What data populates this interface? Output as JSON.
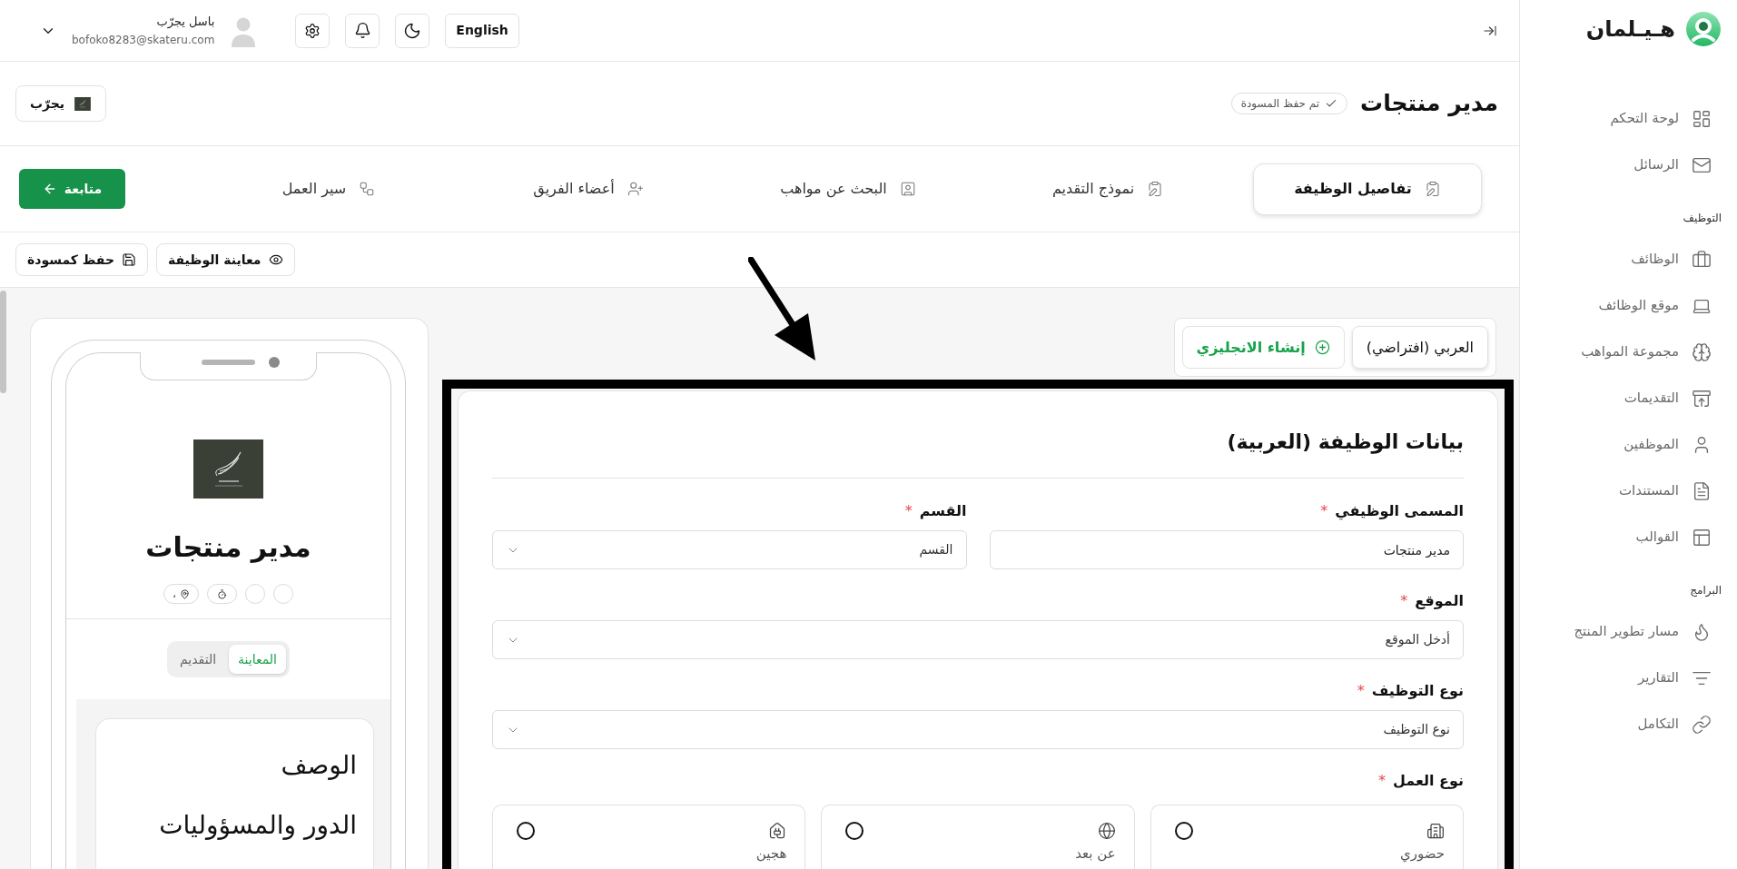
{
  "topbar": {
    "language_button": "English",
    "user": {
      "name": "باسل يجرّب",
      "email": "bofoko8283@skateru.com"
    }
  },
  "sidebar": {
    "logo_text": "هـيـلمان",
    "sections": [
      {
        "items": [
          {
            "label": "لوحة التحكم",
            "selected": false
          },
          {
            "label": "الرسائل",
            "selected": false
          }
        ]
      },
      {
        "heading": "التوظيف",
        "items": [
          {
            "label": "الوظائف",
            "selected": false
          },
          {
            "label": "موقع الوظائف",
            "selected": false
          },
          {
            "label": "مجموعة المواهب",
            "selected": false
          },
          {
            "label": "التقديمات",
            "selected": false
          },
          {
            "label": "الموظفين",
            "selected": false
          },
          {
            "label": "المستندات",
            "selected": false
          },
          {
            "label": "القوالب",
            "selected": false
          }
        ]
      },
      {
        "heading": "البرامج",
        "items": [
          {
            "label": "مسار تطوير المنتج",
            "selected": false
          },
          {
            "label": "التقارير",
            "selected": false
          },
          {
            "label": "التكامل",
            "selected": false
          }
        ]
      }
    ]
  },
  "header": {
    "title": "مدير منتجات",
    "save_status": "تم حفظ المسودة",
    "company_button": "يجرّب"
  },
  "steps": [
    {
      "label": "تفاصيل الوظيفة",
      "selected": true
    },
    {
      "label": "نموذج التقديم",
      "selected": false
    },
    {
      "label": "البحث عن مواهب",
      "selected": false
    },
    {
      "label": "أعضاء الفريق",
      "selected": false
    },
    {
      "label": "سير العمل",
      "selected": false
    }
  ],
  "continue_button": "متابعة",
  "actions": [
    {
      "kind": "preview",
      "label": "معاينة الوظيفة"
    },
    {
      "kind": "save",
      "label": "حفظ كمسودة"
    }
  ],
  "language_tabs": [
    {
      "kind": "language",
      "label": "العربي (افتراضي)",
      "selected": true
    },
    {
      "kind": "create",
      "label": "إنشاء الانجليزي",
      "selected": false
    }
  ],
  "form": {
    "title": "بيانات الوظيفة (العربية)",
    "required_mark": "*",
    "rows": [
      [
        {
          "kind": "text",
          "label": "المسمى الوظيفي",
          "required": true,
          "value": "مدير منتجات"
        },
        {
          "kind": "select",
          "label": "القسم",
          "required": true,
          "placeholder": "القسم"
        }
      ],
      [
        {
          "kind": "select",
          "label": "الموقع",
          "required": true,
          "placeholder": "أدخل الموقع"
        }
      ],
      [
        {
          "kind": "select",
          "label": "نوع التوظيف",
          "required": true,
          "placeholder": "نوع التوظيف"
        }
      ]
    ],
    "work_type": {
      "label": "نوع العمل",
      "required": true,
      "options": [
        {
          "kind": "onsite",
          "label": "حضوري",
          "selected": false
        },
        {
          "kind": "remote",
          "label": "عن بعد",
          "selected": false
        },
        {
          "kind": "hybrid",
          "label": "هجين",
          "selected": false
        }
      ]
    }
  },
  "preview": {
    "title": "مدير منتجات",
    "chips": [
      {
        "kind": "empty"
      },
      {
        "kind": "empty"
      },
      {
        "kind": "duration"
      },
      {
        "kind": "location",
        "text": "،"
      }
    ],
    "tabs": [
      {
        "label": "المعاينة",
        "selected": true
      },
      {
        "label": "التقديم",
        "selected": false
      }
    ],
    "sections": [
      "الوصف",
      "الدور والمسؤوليات"
    ]
  }
}
